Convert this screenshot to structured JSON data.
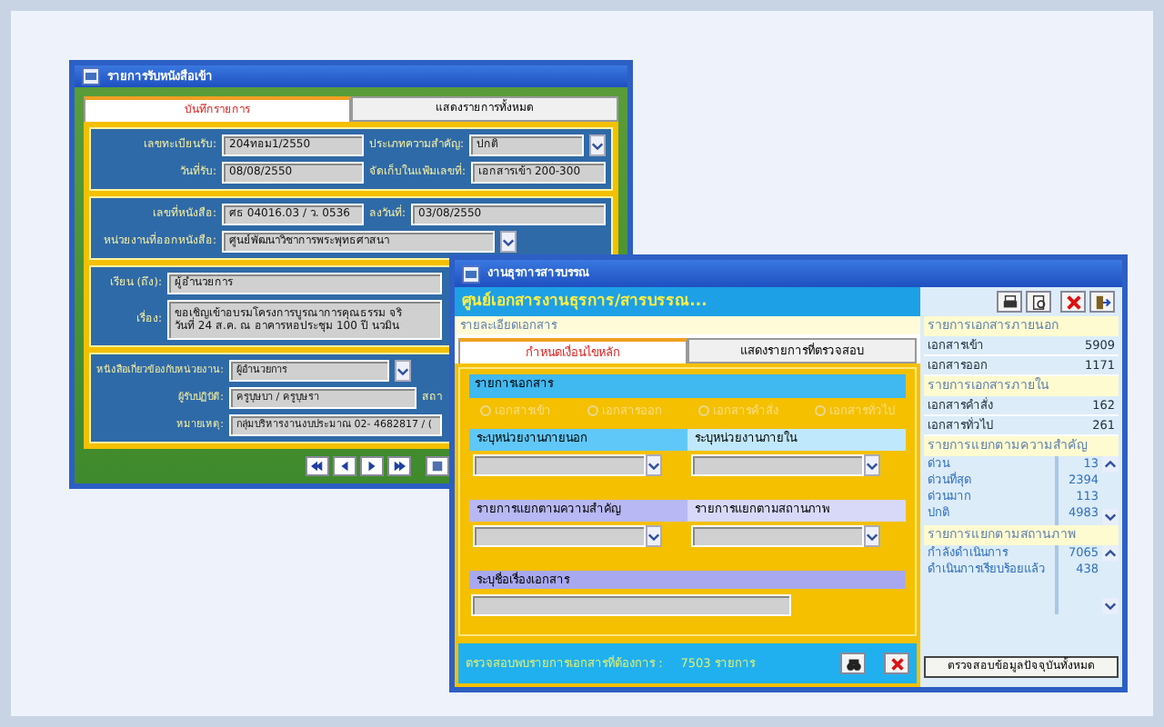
{
  "window_1": {
    "title": "รายการรับหนังสือเข้า",
    "tabs": [
      {
        "label": "บันทึกรายการ",
        "selected": true
      },
      {
        "label": "แสดงรายการทั้งหมด",
        "selected": false
      }
    ],
    "sections": [
      {
        "rows": [
          [
            {
              "label": "เลขทะเบียนรับ:",
              "value": "204ทอม1/2550",
              "kind": "text"
            },
            {
              "label": "ประเภทความสำคัญ:",
              "value": "ปกติ",
              "kind": "dropdown"
            }
          ],
          [
            {
              "label": "วันที่รับ:",
              "value": "08/08/2550",
              "kind": "text"
            },
            {
              "label": "จัดเก็บในแฟ้มเลขที่:",
              "value": "เอกสารเข้า 200-300",
              "kind": "text"
            }
          ]
        ]
      },
      {
        "rows": [
          [
            {
              "label": "เลขที่หนังสือ:",
              "value": "ศธ 04016.03 / ว. 0536",
              "kind": "text"
            },
            {
              "label": "ลงวันที่:",
              "value": "03/08/2550",
              "kind": "text"
            }
          ],
          [
            {
              "label": "หน่วยงานที่ออกหนังสือ:",
              "value": "ศูนย์พัฒนาวิชาการพระพุทธศาสนา",
              "kind": "dropdown"
            }
          ]
        ]
      },
      {
        "rows": [
          [
            {
              "label": "เรียน (ถึง):",
              "value": "ผู้อำนวยการ",
              "kind": "text"
            }
          ],
          [
            {
              "label": "เรื่อง:",
              "value": "ขอเชิญเข้าอบรมโครงการบูรณาการคุณธรรม จริ",
              "value_2": "วันที่ 24 ส.ค. ณ อาคารหอประชุม 100 ปี นวมิน",
              "kind": "memo"
            }
          ]
        ]
      },
      {
        "rows": [
          [
            {
              "label": "หนังสือเกี่ยวข้องกับหน่วยงาน:",
              "value": "ผู้อำนวยการ",
              "kind": "dropdown"
            }
          ],
          [
            {
              "label": "ผู้รับปฏิบัติ:",
              "value": "ครูบุษบา / ครูบุษรา",
              "kind": "text"
            },
            {
              "label": "สถา",
              "kind": "label"
            }
          ],
          [
            {
              "label": "หมายเหตุ:",
              "value": "กลุ่มบริหารงานงบประมาณ 02- 4682817 / (",
              "kind": "text"
            }
          ]
        ]
      }
    ]
  },
  "window_2": {
    "title": "งานธุรการสารบรรณ",
    "header": "ศูนย์เอกสารงานธุรการ/สารบรรณ...",
    "subtitle": "รายละเอียดเอกสาร",
    "tabs": [
      {
        "label": "กำหนดเงื่อนไขหลัก",
        "selected": true
      },
      {
        "label": "แสดงรายการที่ตรวจสอบ",
        "selected": false
      }
    ],
    "document_types": {
      "title": "รายการเอกสาร",
      "options": [
        {
          "label": "เอกสารเข้า",
          "selected": false,
          "disabled": true
        },
        {
          "label": "เอกสารออก",
          "selected": false,
          "disabled": true
        },
        {
          "label": "เอกสารคำสั่ง",
          "selected": false,
          "disabled": true
        },
        {
          "label": "เอกสารทั่วไป",
          "selected": false,
          "disabled": true
        }
      ]
    },
    "filters": [
      [
        {
          "label": "ระบุหน่วยงานภายนอก"
        },
        {
          "label": "ระบุหน่วยงานภายใน"
        }
      ],
      [
        {
          "label": "รายการแยกตามความสำคัญ"
        },
        {
          "label": "รายการแยกตามสถานภาพ"
        }
      ]
    ],
    "subject_label": "ระบุชื่อเรื่องเอกสาร",
    "result_label": "ตรวจสอบพบรายการเอกสารที่ต้องการ :",
    "result_count": "7503 รายการ",
    "summary": [
      {
        "title": "รายการเอกสารภายนอก",
        "kind": "table",
        "items": [
          {
            "name": "เอกสารเข้า",
            "count": "5909"
          },
          {
            "name": "เอกสารออก",
            "count": "1171"
          }
        ]
      },
      {
        "title": "รายการเอกสารภายใน",
        "kind": "table",
        "items": [
          {
            "name": "เอกสารคำสั่ง",
            "count": "162"
          },
          {
            "name": "เอกสารทั่วไป",
            "count": "261"
          }
        ]
      },
      {
        "title": "รายการแยกตามความสำคัญ",
        "kind": "list",
        "items": [
          {
            "name": "ด่วน",
            "count": "13"
          },
          {
            "name": "ด่วนที่สุด",
            "count": "2394"
          },
          {
            "name": "ด่วนมาก",
            "count": "113"
          },
          {
            "name": "ปกติ",
            "count": "4983"
          }
        ]
      },
      {
        "title": "รายการแยกตามสถานภาพ",
        "kind": "list",
        "items": [
          {
            "name": "กำลังดำเนินการ",
            "count": "7065"
          },
          {
            "name": "ดำเนินการเรียบร้อยแล้ว",
            "count": "438"
          }
        ]
      }
    ],
    "refresh_button": "ตรวจสอบข้อมูลปัจจุบันทั้งหมด"
  }
}
